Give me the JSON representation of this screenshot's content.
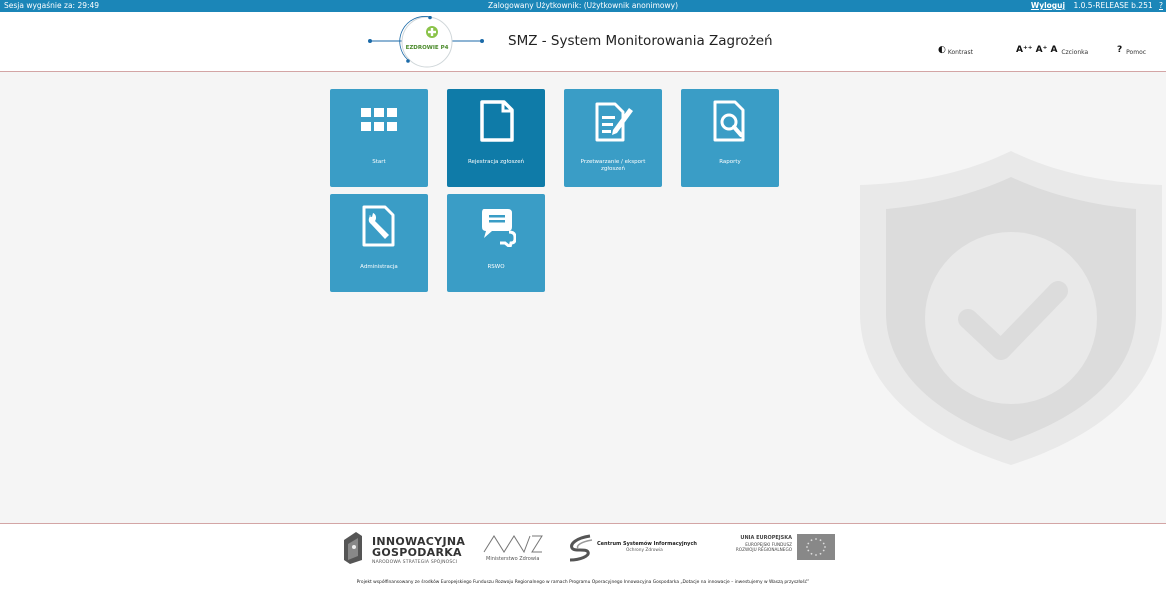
{
  "topbar": {
    "session": "Sesja wygaśnie za: 29:49",
    "user": "Zalogowany Użytkownik: (Użytkownik anonimowy)",
    "logout": "Wyloguj",
    "version": "1.0.5-RELEASE b.251",
    "help": "?"
  },
  "header": {
    "logo_text": "EZDROWIE P4",
    "title": "SMZ - System Monitorowania Zagrożeń",
    "contrast_label": "Kontrast",
    "font_glyphs": "A⁺⁺ A⁺ A",
    "font_label": "Czcionka",
    "help_glyph": "?",
    "help_label": "Pomoc"
  },
  "tiles": [
    {
      "label": "Start",
      "icon": "grid-icon"
    },
    {
      "label": "Rejestracja zgłoszeń",
      "icon": "document-icon"
    },
    {
      "label": "Przetwarzanie / eksport zgłoszeń",
      "icon": "edit-document-icon"
    },
    {
      "label": "Raporty",
      "icon": "search-document-icon"
    },
    {
      "label": "Administracja",
      "icon": "wrench-document-icon"
    },
    {
      "label": "RSWO",
      "icon": "chat-bubbles-icon"
    }
  ],
  "footer": {
    "ig_title_1": "INNOWACYJNA",
    "ig_title_2": "GOSPODARKA",
    "ig_sub": "NARODOWA STRATEGIA SPÓJNOŚCI",
    "mz_name": "Ministerstwo Zdrowia",
    "csi_name": "Centrum Systemów Informacyjnych",
    "csi_sub": "Ochrony Zdrowia",
    "eu_title": "UNIA EUROPEJSKA",
    "eu_line1": "EUROPEJSKI FUNDUSZ",
    "eu_line2": "ROZWOJU REGIONALNEGO",
    "note": "Projekt współfinansowany ze środków Europejskiego Funduszu Rozwoju Regionalnego w ramach Programu Operacyjnego Innowacyjna Gospodarka „Dotacje na innowacje – inwestujemy w Waszą przyszłość”"
  },
  "colors": {
    "accent": "#1b86b8",
    "tile": "#3a9dc6",
    "tile_active": "#0f7ba8",
    "header_border": "#d3a5a5",
    "logo_green": "#8bc34a"
  }
}
